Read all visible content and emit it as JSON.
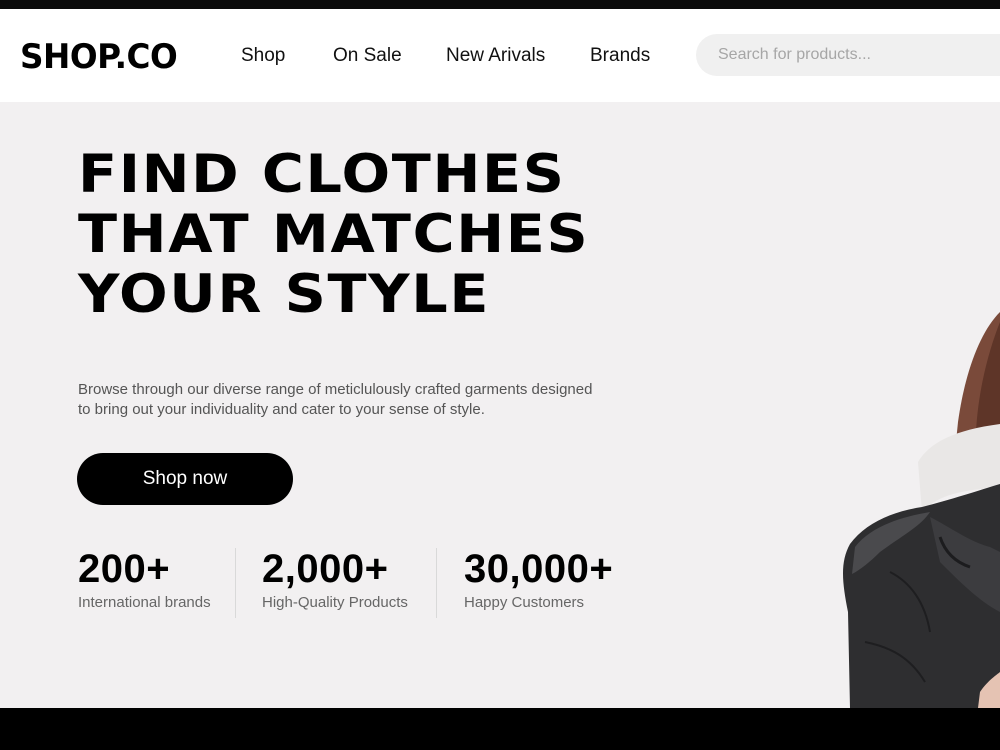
{
  "brand": {
    "logo": "SHOP.CO"
  },
  "nav": {
    "items": [
      {
        "label": "Shop"
      },
      {
        "label": "On Sale"
      },
      {
        "label": "New Arivals"
      },
      {
        "label": "Brands"
      }
    ]
  },
  "search": {
    "placeholder": "Search for products...",
    "value": ""
  },
  "hero": {
    "headline_lines": [
      "FIND CLOTHES",
      "THAT MATCHES",
      "YOUR STYLE"
    ],
    "description_line1": "Browse through our diverse range of meticlulously crafted garments designed",
    "description_line2": "to bring out your individuality and cater to your sense of style.",
    "cta_label": "Shop now",
    "stats": [
      {
        "value": "200+",
        "label": "International brands"
      },
      {
        "value": "2,000+",
        "label": "High-Quality Products"
      },
      {
        "value": "30,000+",
        "label": "Happy Customers"
      }
    ]
  },
  "colors": {
    "hero_background": "#f2f0f1",
    "navbar_background": "#ffffff",
    "cta_background": "#000000",
    "search_background": "#f0f0f0"
  }
}
